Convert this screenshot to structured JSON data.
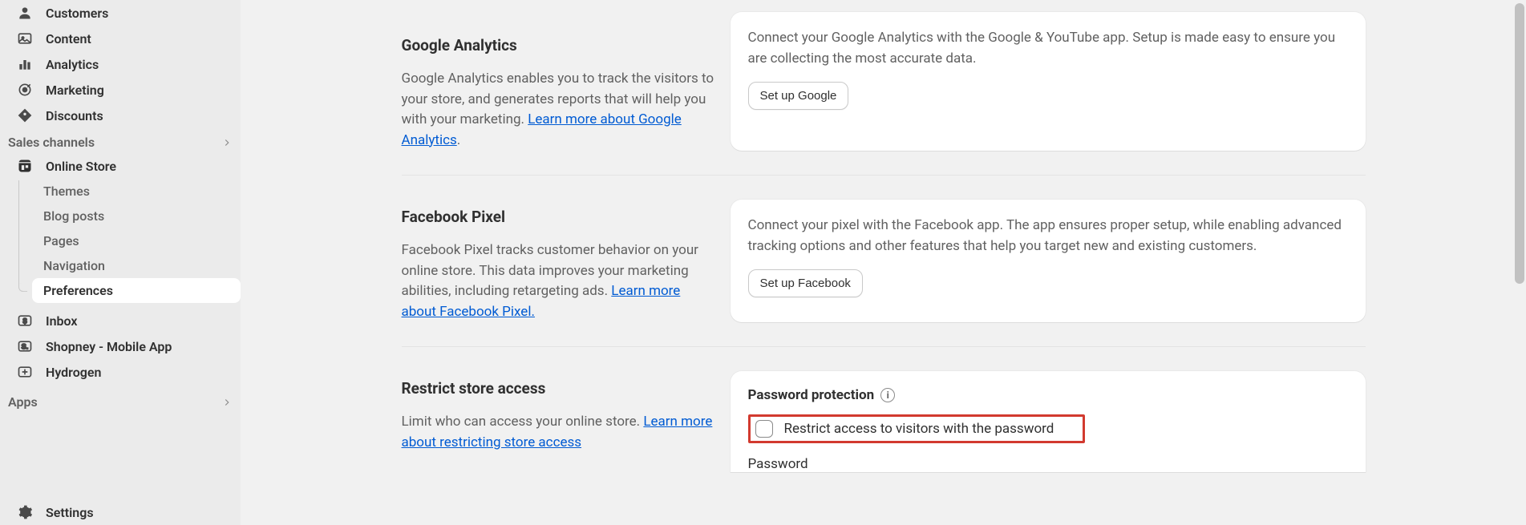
{
  "sidebar": {
    "primary": [
      {
        "id": "customers",
        "label": "Customers",
        "icon": "user-icon"
      },
      {
        "id": "content",
        "label": "Content",
        "icon": "image-icon"
      },
      {
        "id": "analytics",
        "label": "Analytics",
        "icon": "bars-icon"
      },
      {
        "id": "marketing",
        "label": "Marketing",
        "icon": "target-icon"
      },
      {
        "id": "discounts",
        "label": "Discounts",
        "icon": "tag-icon"
      }
    ],
    "sales_channels_label": "Sales channels",
    "online_store_label": "Online Store",
    "online_store_sub": [
      {
        "id": "themes",
        "label": "Themes"
      },
      {
        "id": "blog-posts",
        "label": "Blog posts"
      },
      {
        "id": "pages",
        "label": "Pages"
      },
      {
        "id": "navigation",
        "label": "Navigation"
      },
      {
        "id": "preferences",
        "label": "Preferences",
        "active": true
      }
    ],
    "inbox_label": "Inbox",
    "shopney_label": "Shopney - Mobile App",
    "hydrogen_label": "Hydrogen",
    "apps_label": "Apps",
    "settings_label": "Settings"
  },
  "sections": {
    "ga": {
      "title": "Google Analytics",
      "desc_a": "Google Analytics enables you to track the visitors to your store, and generates reports that will help you with your marketing. ",
      "link_text": "Learn more about Google Analytics",
      "card_text": "Connect your Google Analytics with the Google & YouTube app. Setup is made easy to ensure you are collecting the most accurate data.",
      "button": "Set up Google"
    },
    "fb": {
      "title": "Facebook Pixel",
      "desc_a": "Facebook Pixel tracks customer behavior on your online store. This data improves your marketing abilities, including retargeting ads. ",
      "link_text": "Learn more about Facebook Pixel.",
      "card_text": "Connect your pixel with the Facebook app. The app ensures proper setup, while enabling advanced tracking options and other features that help you target new and existing customers.",
      "button": "Set up Facebook"
    },
    "restrict": {
      "title": "Restrict store access",
      "desc_a": "Limit who can access your online store. ",
      "link_text": "Learn more about restricting store access",
      "card_heading": "Password protection",
      "checkbox_label": "Restrict access to visitors with the password",
      "password_label": "Password"
    }
  }
}
